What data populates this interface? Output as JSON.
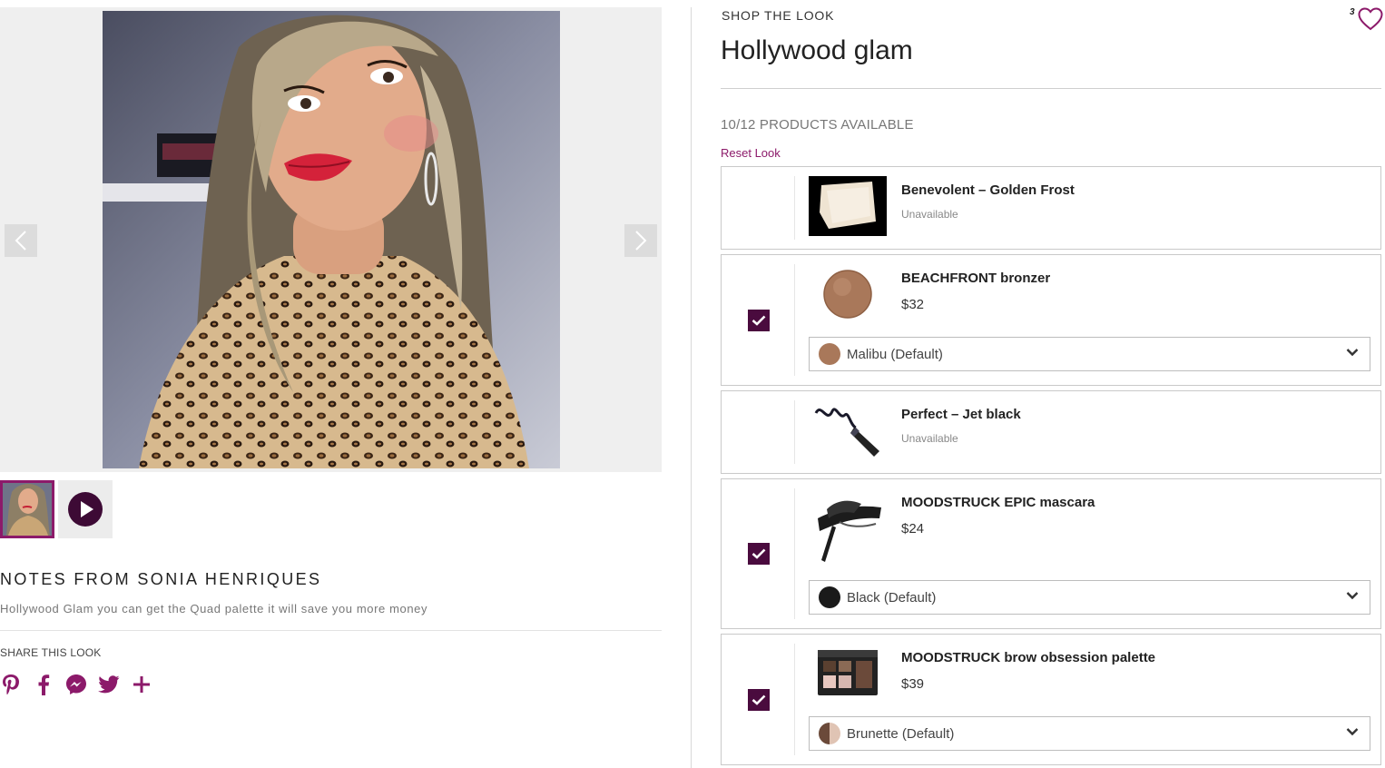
{
  "colors": {
    "accent": "#8c1a6a",
    "checkbox": "#4a0b3e",
    "muted": "#777777"
  },
  "gallery": {
    "prev_icon": "chevron-left-icon",
    "next_icon": "chevron-right-icon",
    "thumbnails": [
      {
        "kind": "image",
        "active": true
      },
      {
        "kind": "video",
        "icon": "play-icon",
        "active": false
      }
    ]
  },
  "notes": {
    "title": "NOTES FROM SONIA HENRIQUES",
    "text": "Hollywood Glam you can get the Quad palette it will save you more money"
  },
  "share": {
    "title": "SHARE THIS LOOK",
    "icons": [
      "pinterest-icon",
      "facebook-icon",
      "messenger-icon",
      "twitter-icon",
      "plus-icon"
    ]
  },
  "look": {
    "kicker": "SHOP THE LOOK",
    "title": "Hollywood glam",
    "favorite_count": "3",
    "availability": "10/12 PRODUCTS AVAILABLE",
    "reset_label": "Reset Look"
  },
  "products": [
    {
      "name": "Benevolent – Golden Frost",
      "status": "Unavailable",
      "checked": false
    },
    {
      "name": "BEACHFRONT bronzer",
      "price": "$32",
      "checked": true,
      "shade": "Malibu (Default)",
      "shade_color": "#a9785a"
    },
    {
      "name": "Perfect – Jet black",
      "status": "Unavailable",
      "checked": false
    },
    {
      "name": "MOODSTRUCK EPIC mascara",
      "price": "$24",
      "checked": true,
      "shade": "Black (Default)",
      "shade_color": "#1a1a1a"
    },
    {
      "name": "MOODSTRUCK brow obsession palette",
      "price": "$39",
      "checked": true,
      "shade": "Brunette (Default)",
      "shade_color": "#6b4a3a"
    }
  ]
}
